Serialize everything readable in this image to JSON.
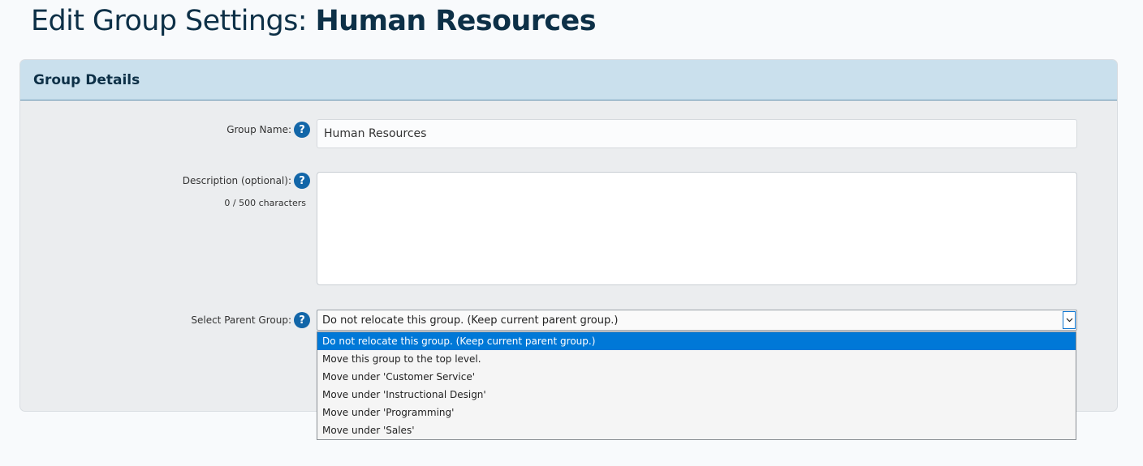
{
  "page": {
    "title_prefix": "Edit Group Settings: ",
    "title_name": "Human Resources"
  },
  "panel": {
    "header": "Group Details"
  },
  "form": {
    "group_name_label": "Group Name:",
    "group_name_value": "Human Resources",
    "description_label": "Description (optional):",
    "description_value": "",
    "description_counter": "0 / 500 characters",
    "parent_label": "Select Parent Group:",
    "help_glyph": "?",
    "parent_selected": "Do not relocate this group. (Keep current parent group.)",
    "parent_options": [
      "Do not relocate this group. (Keep current parent group.)",
      "Move this group to the top level.",
      "Move under 'Customer Service'",
      "Move under 'Instructional Design'",
      "Move under 'Programming'",
      "Move under 'Sales'"
    ]
  },
  "colors": {
    "title": "#0d3047",
    "panel_header_bg": "#cae0ed",
    "help_icon": "#1266a8",
    "option_highlight": "#0078d7"
  }
}
